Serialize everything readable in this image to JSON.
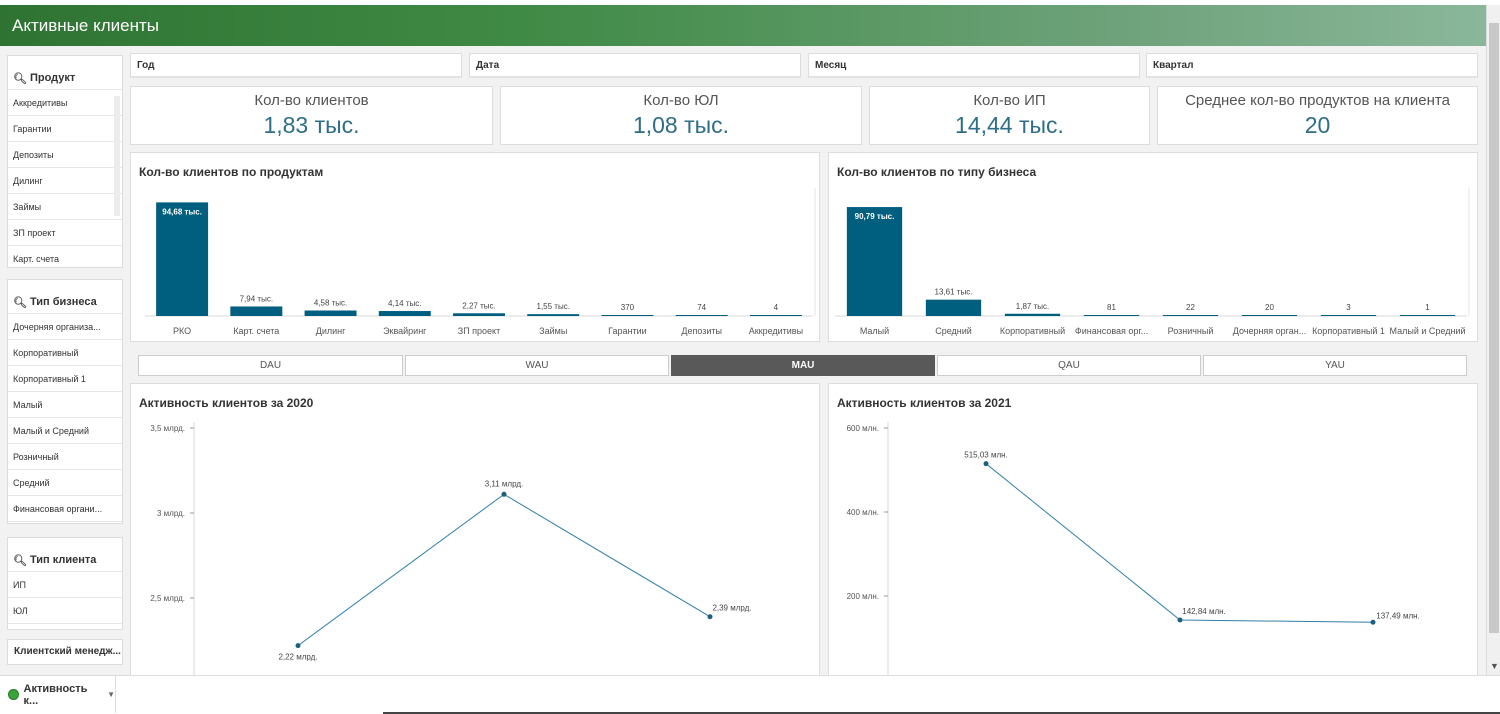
{
  "app": {
    "title": "Активные клиенты"
  },
  "filters_left": {
    "product": {
      "title": "Продукт",
      "items": [
        "Аккредитивы",
        "Гарантии",
        "Депозиты",
        "Дилинг",
        "Займы",
        "ЗП проект",
        "Карт. счета"
      ]
    },
    "business_type": {
      "title": "Тип бизнеса",
      "items": [
        "Дочерняя организа...",
        "Корпоративный",
        "Корпоративный 1",
        "Малый",
        "Малый и Средний",
        "Розничный",
        "Средний",
        "Финансовая органи..."
      ]
    },
    "client_type": {
      "title": "Тип клиента",
      "items": [
        "ИП",
        "ЮЛ"
      ]
    },
    "manager": {
      "title": "Клиентский менедж..."
    }
  },
  "filters_top": [
    "Год",
    "Дата",
    "Месяц",
    "Квартал"
  ],
  "kpis": [
    {
      "label": "Кол-во клиентов",
      "value": "1,83 тыс."
    },
    {
      "label": "Кол-во ЮЛ",
      "value": "1,08 тыс."
    },
    {
      "label": "Кол-во ИП",
      "value": "14,44 тыс."
    },
    {
      "label": "Среднее кол-во продуктов на клиента",
      "value": "20"
    }
  ],
  "tabs": {
    "items": [
      "DAU",
      "WAU",
      "MAU",
      "QAU",
      "YAU"
    ],
    "active": "MAU"
  },
  "sheet": {
    "name": "Активность к..."
  },
  "colors": {
    "bar": "#005f7f",
    "line": "#2f7fa8",
    "kpi_value": "#2e6e87",
    "header_start": "#2f7332",
    "tab_active": "#595959"
  },
  "chart_data": [
    {
      "type": "bar",
      "title": "Кол-во клиентов по продуктам",
      "categories": [
        "РКО",
        "Карт. счета",
        "Дилинг",
        "Эквайринг",
        "ЗП проект",
        "Займы",
        "Гарантии",
        "Депозиты",
        "Аккредитивы"
      ],
      "values": [
        94680,
        7940,
        4580,
        4140,
        2270,
        1550,
        370,
        74,
        4
      ],
      "data_labels": [
        "94,68 тыс.",
        "7,94 тыс.",
        "4,58 тыс.",
        "4,14 тыс.",
        "2,27 тыс.",
        "1,55 тыс.",
        "370",
        "74",
        "4"
      ],
      "ylim": [
        0,
        100000
      ]
    },
    {
      "type": "bar",
      "title": "Кол-во клиентов по типу бизнеса",
      "categories": [
        "Малый",
        "Средний",
        "Корпоративный",
        "Финансовая орг...",
        "Розничный",
        "Дочерняя орган...",
        "Корпоративный 1",
        "Малый и Средний"
      ],
      "values": [
        90790,
        13610,
        1870,
        81,
        22,
        20,
        3,
        1
      ],
      "data_labels": [
        "90,79 тыс.",
        "13,61 тыс.",
        "1,87 тыс.",
        "81",
        "22",
        "20",
        "3",
        "1"
      ],
      "ylim": [
        0,
        100000
      ]
    },
    {
      "type": "line",
      "title": "Активность клиентов за 2020",
      "values": [
        2.22,
        3.11,
        2.39
      ],
      "data_labels": [
        "2,22 млрд.",
        "3,11 млрд.",
        "2,39 млрд."
      ],
      "y_ticks": [
        {
          "v": 3.5,
          "label": "3,5 млрд."
        },
        {
          "v": 3.0,
          "label": "3 млрд."
        },
        {
          "v": 2.5,
          "label": "2,5 млрд."
        }
      ],
      "ylim": [
        2.0,
        3.5
      ]
    },
    {
      "type": "line",
      "title": "Активность клиентов за 2021",
      "values": [
        515.03,
        142.84,
        137.49
      ],
      "data_labels": [
        "515,03 млн.",
        "142,84 млн.",
        "137,49 млн."
      ],
      "y_ticks": [
        {
          "v": 600,
          "label": "600 млн."
        },
        {
          "v": 400,
          "label": "400 млн."
        },
        {
          "v": 200,
          "label": "200 млн."
        }
      ],
      "ylim": [
        0,
        600
      ]
    }
  ]
}
